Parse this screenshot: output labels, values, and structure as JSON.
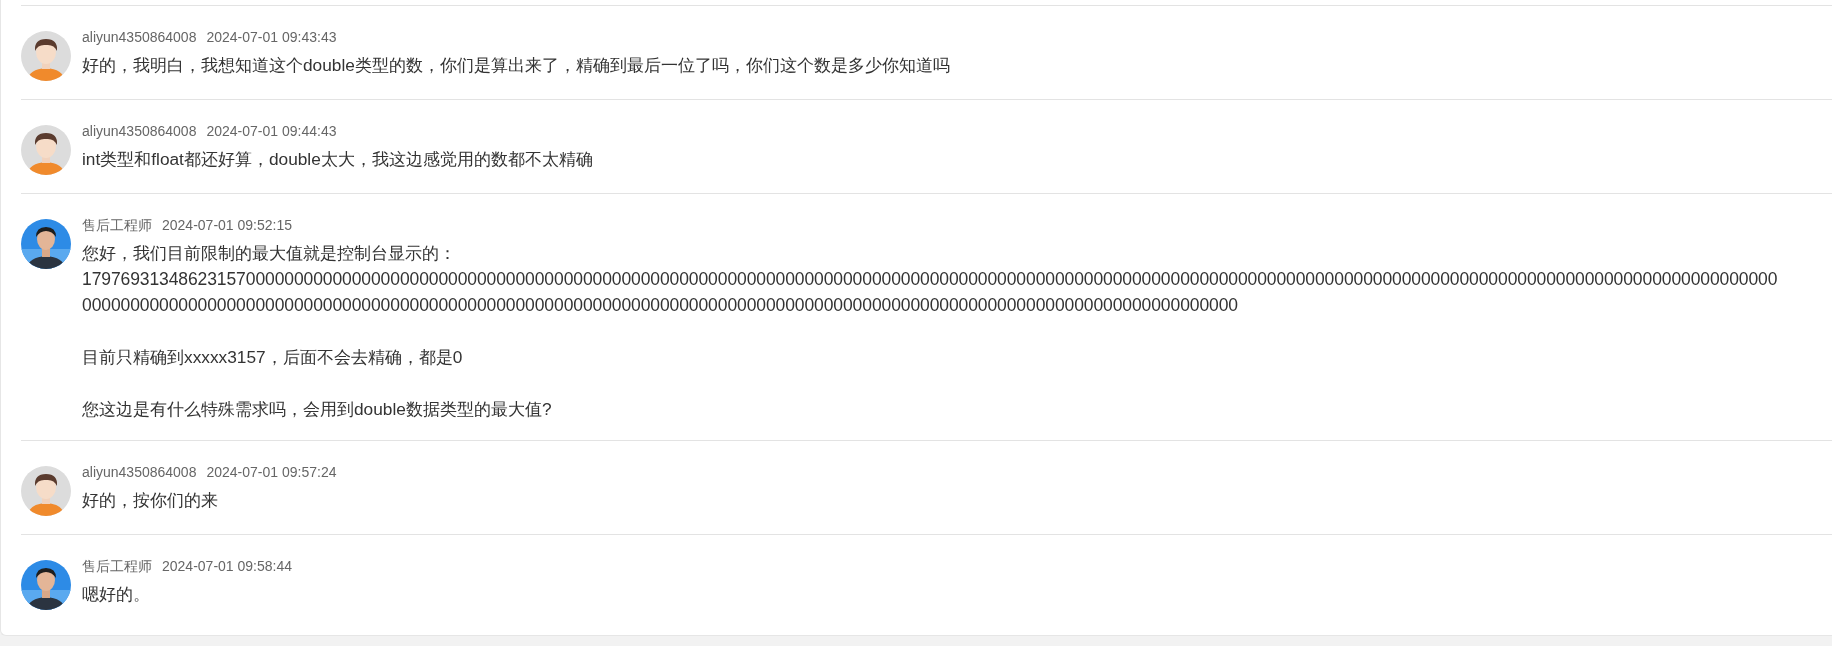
{
  "comments": [
    {
      "kind": "user",
      "author": "aliyun4350864008",
      "time": "2024-07-01 09:43:43",
      "paragraphs": [
        [
          "好的，我明白，我想知道这个double类型的数，你们是算出来了，精确到最后一位了吗，你们这个数是多少你知道吗"
        ]
      ]
    },
    {
      "kind": "user",
      "author": "aliyun4350864008",
      "time": "2024-07-01 09:44:43",
      "paragraphs": [
        [
          "int类型和float都还好算，double太大，我这边感觉用的数都不太精确"
        ]
      ]
    },
    {
      "kind": "engineer",
      "author": "售后工程师",
      "time": "2024-07-01 09:52:15",
      "paragraphs": [
        [
          "您好，我们目前限制的最大值就是控制台显示的：",
          "17976931348623157000000000000000000000000000000000000000000000000000000000000000000000000000000000000000000000000000000000000000000000000000000000000000000000000000000000000000",
          "000000000000000000000000000000000000000000000000000000000000000000000000000000000000000000000000000000000000000000000000"
        ],
        [
          "目前只精确到xxxxx3157，后面不会去精确，都是0"
        ],
        [
          "您这边是有什么特殊需求吗，会用到double数据类型的最大值?"
        ]
      ]
    },
    {
      "kind": "user",
      "author": "aliyun4350864008",
      "time": "2024-07-01 09:57:24",
      "paragraphs": [
        [
          "好的，按你们的来"
        ]
      ]
    },
    {
      "kind": "engineer",
      "author": "售后工程师",
      "time": "2024-07-01 09:58:44",
      "paragraphs": [
        [
          "嗯好的。"
        ]
      ]
    }
  ]
}
